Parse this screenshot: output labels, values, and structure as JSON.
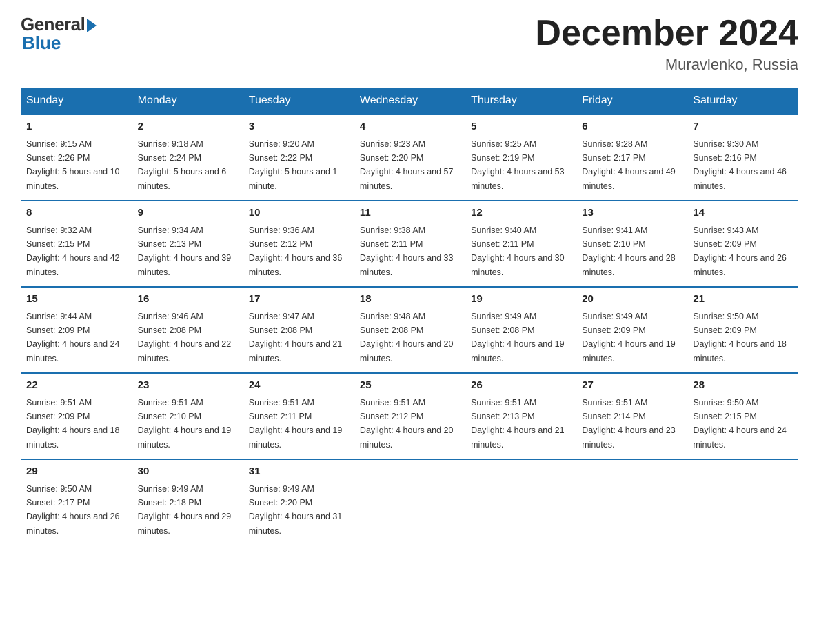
{
  "header": {
    "logo_general": "General",
    "logo_blue": "Blue",
    "month_title": "December 2024",
    "location": "Muravlenko, Russia"
  },
  "days_of_week": [
    "Sunday",
    "Monday",
    "Tuesday",
    "Wednesday",
    "Thursday",
    "Friday",
    "Saturday"
  ],
  "weeks": [
    [
      {
        "day": "1",
        "sunrise": "9:15 AM",
        "sunset": "2:26 PM",
        "daylight": "5 hours and 10 minutes."
      },
      {
        "day": "2",
        "sunrise": "9:18 AM",
        "sunset": "2:24 PM",
        "daylight": "5 hours and 6 minutes."
      },
      {
        "day": "3",
        "sunrise": "9:20 AM",
        "sunset": "2:22 PM",
        "daylight": "5 hours and 1 minute."
      },
      {
        "day": "4",
        "sunrise": "9:23 AM",
        "sunset": "2:20 PM",
        "daylight": "4 hours and 57 minutes."
      },
      {
        "day": "5",
        "sunrise": "9:25 AM",
        "sunset": "2:19 PM",
        "daylight": "4 hours and 53 minutes."
      },
      {
        "day": "6",
        "sunrise": "9:28 AM",
        "sunset": "2:17 PM",
        "daylight": "4 hours and 49 minutes."
      },
      {
        "day": "7",
        "sunrise": "9:30 AM",
        "sunset": "2:16 PM",
        "daylight": "4 hours and 46 minutes."
      }
    ],
    [
      {
        "day": "8",
        "sunrise": "9:32 AM",
        "sunset": "2:15 PM",
        "daylight": "4 hours and 42 minutes."
      },
      {
        "day": "9",
        "sunrise": "9:34 AM",
        "sunset": "2:13 PM",
        "daylight": "4 hours and 39 minutes."
      },
      {
        "day": "10",
        "sunrise": "9:36 AM",
        "sunset": "2:12 PM",
        "daylight": "4 hours and 36 minutes."
      },
      {
        "day": "11",
        "sunrise": "9:38 AM",
        "sunset": "2:11 PM",
        "daylight": "4 hours and 33 minutes."
      },
      {
        "day": "12",
        "sunrise": "9:40 AM",
        "sunset": "2:11 PM",
        "daylight": "4 hours and 30 minutes."
      },
      {
        "day": "13",
        "sunrise": "9:41 AM",
        "sunset": "2:10 PM",
        "daylight": "4 hours and 28 minutes."
      },
      {
        "day": "14",
        "sunrise": "9:43 AM",
        "sunset": "2:09 PM",
        "daylight": "4 hours and 26 minutes."
      }
    ],
    [
      {
        "day": "15",
        "sunrise": "9:44 AM",
        "sunset": "2:09 PM",
        "daylight": "4 hours and 24 minutes."
      },
      {
        "day": "16",
        "sunrise": "9:46 AM",
        "sunset": "2:08 PM",
        "daylight": "4 hours and 22 minutes."
      },
      {
        "day": "17",
        "sunrise": "9:47 AM",
        "sunset": "2:08 PM",
        "daylight": "4 hours and 21 minutes."
      },
      {
        "day": "18",
        "sunrise": "9:48 AM",
        "sunset": "2:08 PM",
        "daylight": "4 hours and 20 minutes."
      },
      {
        "day": "19",
        "sunrise": "9:49 AM",
        "sunset": "2:08 PM",
        "daylight": "4 hours and 19 minutes."
      },
      {
        "day": "20",
        "sunrise": "9:49 AM",
        "sunset": "2:09 PM",
        "daylight": "4 hours and 19 minutes."
      },
      {
        "day": "21",
        "sunrise": "9:50 AM",
        "sunset": "2:09 PM",
        "daylight": "4 hours and 18 minutes."
      }
    ],
    [
      {
        "day": "22",
        "sunrise": "9:51 AM",
        "sunset": "2:09 PM",
        "daylight": "4 hours and 18 minutes."
      },
      {
        "day": "23",
        "sunrise": "9:51 AM",
        "sunset": "2:10 PM",
        "daylight": "4 hours and 19 minutes."
      },
      {
        "day": "24",
        "sunrise": "9:51 AM",
        "sunset": "2:11 PM",
        "daylight": "4 hours and 19 minutes."
      },
      {
        "day": "25",
        "sunrise": "9:51 AM",
        "sunset": "2:12 PM",
        "daylight": "4 hours and 20 minutes."
      },
      {
        "day": "26",
        "sunrise": "9:51 AM",
        "sunset": "2:13 PM",
        "daylight": "4 hours and 21 minutes."
      },
      {
        "day": "27",
        "sunrise": "9:51 AM",
        "sunset": "2:14 PM",
        "daylight": "4 hours and 23 minutes."
      },
      {
        "day": "28",
        "sunrise": "9:50 AM",
        "sunset": "2:15 PM",
        "daylight": "4 hours and 24 minutes."
      }
    ],
    [
      {
        "day": "29",
        "sunrise": "9:50 AM",
        "sunset": "2:17 PM",
        "daylight": "4 hours and 26 minutes."
      },
      {
        "day": "30",
        "sunrise": "9:49 AM",
        "sunset": "2:18 PM",
        "daylight": "4 hours and 29 minutes."
      },
      {
        "day": "31",
        "sunrise": "9:49 AM",
        "sunset": "2:20 PM",
        "daylight": "4 hours and 31 minutes."
      },
      null,
      null,
      null,
      null
    ]
  ]
}
